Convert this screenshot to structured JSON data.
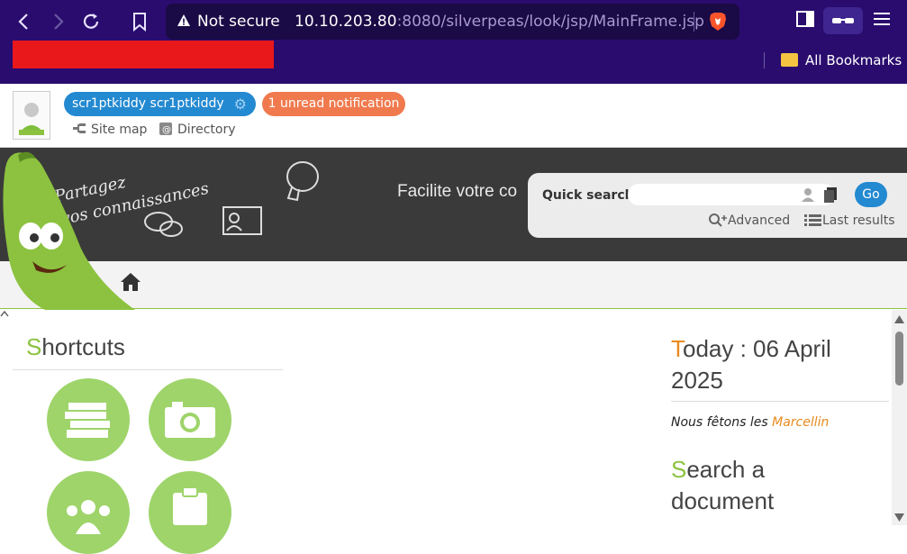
{
  "browser": {
    "url_prefix": "Not secure",
    "url_host": "10.10.203.80",
    "url_rest": ":8080/silverpeas/look/jsp/MainFrame.jsp",
    "bookmarks_label": "All Bookmarks"
  },
  "header": {
    "user_name": "scr1ptkiddy scr1ptkiddy",
    "notifications": "1 unread notification",
    "site_map": "Site map",
    "directory": "Directory"
  },
  "banner": {
    "slogan_1": "Partagez",
    "slogan_2": "vos connaissances",
    "slogan_3": "Facilite votre co"
  },
  "quick_search": {
    "label": "Quick search",
    "go_label": "Go",
    "advanced_label": "Advanced",
    "last_results_label": "Last results"
  },
  "shortcuts": {
    "title_first": "S",
    "title_rest": "hortcuts",
    "items": [
      "books-icon",
      "camera-icon",
      "people-icon",
      "clipboard-icon"
    ]
  },
  "today": {
    "title_first": "T",
    "title_rest": "oday : 06 April",
    "title_line2": "2025",
    "feast_prefix": "Nous fêtons les ",
    "feast_name": "Marcellin"
  },
  "search_doc": {
    "title_first": "S",
    "title_rest": "earch a",
    "title_line2": "document"
  },
  "colors": {
    "brand_green": "#8cc240",
    "brand_blue": "#2389d1",
    "notif_orange": "#f07a4e",
    "accent_orange": "#e88a1e"
  }
}
